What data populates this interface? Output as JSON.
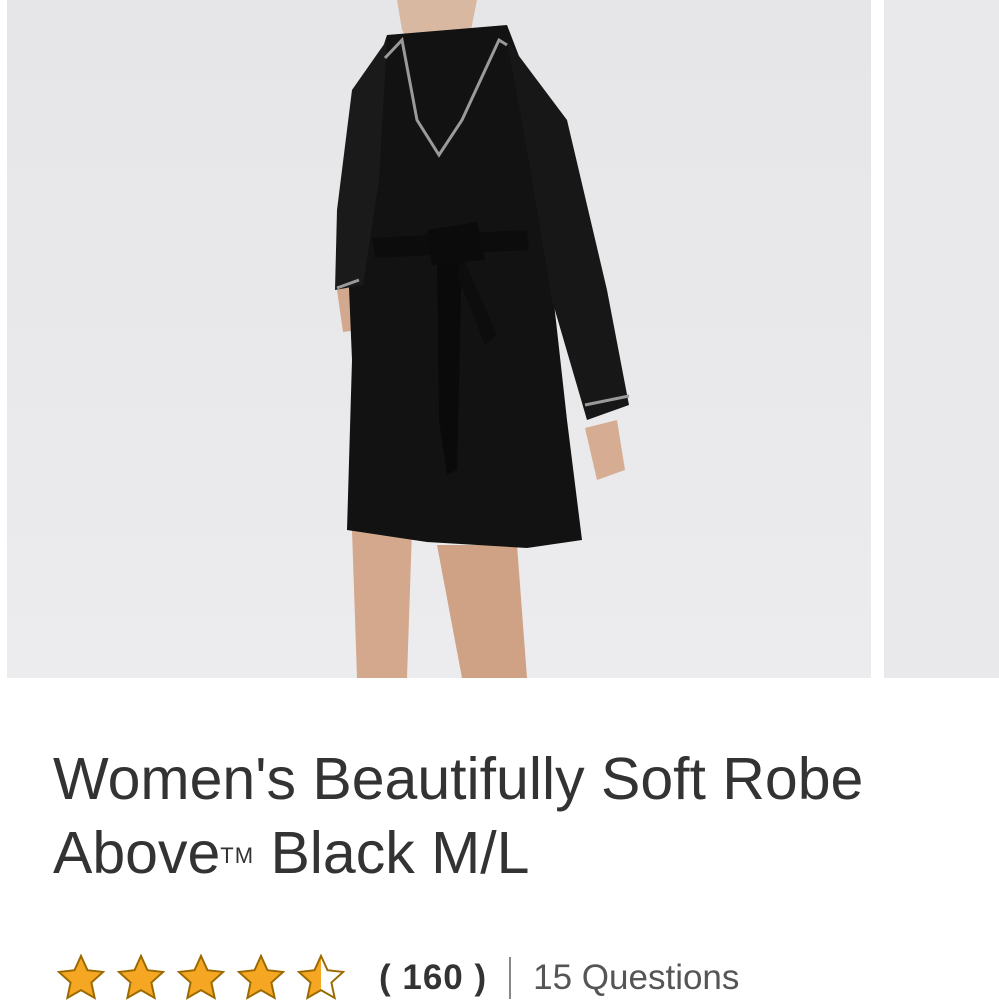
{
  "product": {
    "title_line1": "Women's Beautifully Soft Robe",
    "title_line2_brand": "Above",
    "trademark": "TM",
    "title_line2_rest": " Black M/L",
    "image_alt": "Woman wearing black robe with tie belt",
    "rating_value": 4.5,
    "review_count": "( 160 )",
    "questions": "15 Questions"
  },
  "colors": {
    "star_fill": "#f5a623",
    "star_outline": "#9a6a00",
    "robe": "#111111",
    "background": "#e9e9eb"
  }
}
